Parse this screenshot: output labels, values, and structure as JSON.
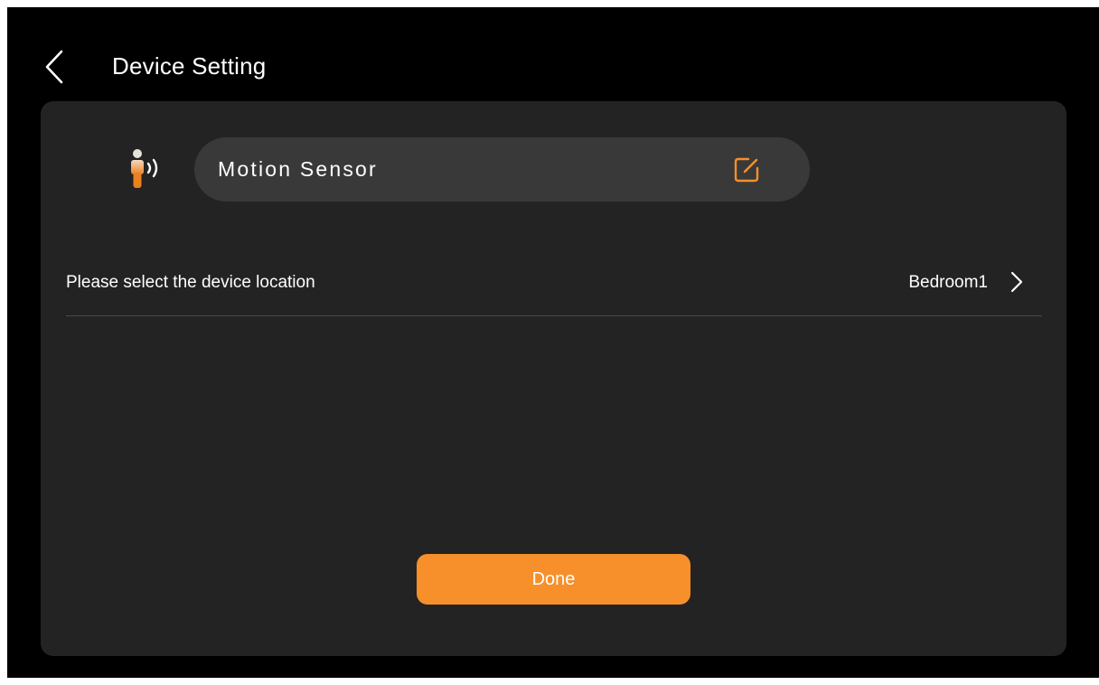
{
  "header": {
    "back_icon": "chevron-left-icon",
    "title": "Device Setting"
  },
  "device": {
    "icon": "motion-sensor-icon",
    "name": "Motion Sensor",
    "edit_icon": "edit-icon"
  },
  "location": {
    "label": "Please select the device location",
    "value": "Bedroom1",
    "chevron_icon": "chevron-right-icon"
  },
  "actions": {
    "done_label": "Done"
  },
  "colors": {
    "background": "#000000",
    "card": "#232323",
    "pill": "#393939",
    "accent": "#f7902a",
    "text": "#ffffff",
    "divider": "#4a4a4a"
  }
}
